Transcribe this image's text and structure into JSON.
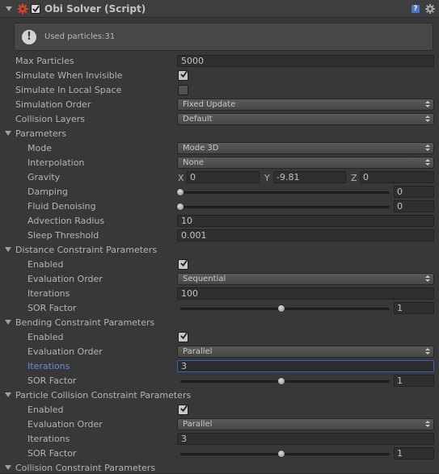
{
  "header": {
    "title": "Obi Solver (Script)",
    "help_glyph": "?",
    "icons": [
      "foldout-arrow-icon",
      "solver-gear-icon",
      "enabled-checkbox",
      "help-icon",
      "settings-gear-icon"
    ]
  },
  "info": {
    "glyph": "!",
    "message": "Used particles:31"
  },
  "rows": {
    "max_particles": {
      "label": "Max Particles",
      "value": "5000"
    },
    "simulate_when_invisible": {
      "label": "Simulate When Invisible",
      "checked": true
    },
    "simulate_in_local_space": {
      "label": "Simulate In Local Space",
      "checked": false
    },
    "simulation_order": {
      "label": "Simulation Order",
      "value": "Fixed Update"
    },
    "collision_layers": {
      "label": "Collision Layers",
      "value": "Default"
    }
  },
  "parameters": {
    "header": "Parameters",
    "mode": {
      "label": "Mode",
      "value": "Mode 3D"
    },
    "interpolation": {
      "label": "Interpolation",
      "value": "None"
    },
    "gravity": {
      "label": "Gravity",
      "x_label": "X",
      "x": "0",
      "y_label": "Y",
      "y": "-9.81",
      "z_label": "Z",
      "z": "0"
    },
    "damping": {
      "label": "Damping",
      "value": "0",
      "level": 0
    },
    "fluid_denoising": {
      "label": "Fluid Denoising",
      "value": "0",
      "level": 0
    },
    "advection_radius": {
      "label": "Advection Radius",
      "value": "10"
    },
    "sleep_threshold": {
      "label": "Sleep Threshold",
      "value": "0.001"
    }
  },
  "distance": {
    "header": "Distance Constraint Parameters",
    "enabled": {
      "label": "Enabled",
      "checked": true
    },
    "evaluation_order": {
      "label": "Evaluation Order",
      "value": "Sequential"
    },
    "iterations": {
      "label": "Iterations",
      "value": "100"
    },
    "sor_factor": {
      "label": "SOR Factor",
      "value": "1",
      "level": 0.5
    }
  },
  "bending": {
    "header": "Bending Constraint Parameters",
    "enabled": {
      "label": "Enabled",
      "checked": true
    },
    "evaluation_order": {
      "label": "Evaluation Order",
      "value": "Parallel"
    },
    "iterations": {
      "label": "Iterations",
      "value": "3"
    },
    "sor_factor": {
      "label": "SOR Factor",
      "value": "1",
      "level": 0.5
    }
  },
  "particle_collision": {
    "header": "Particle Collision Constraint Parameters",
    "enabled": {
      "label": "Enabled",
      "checked": true
    },
    "evaluation_order": {
      "label": "Evaluation Order",
      "value": "Parallel"
    },
    "iterations": {
      "label": "Iterations",
      "value": "3"
    },
    "sor_factor": {
      "label": "SOR Factor",
      "value": "1",
      "level": 0.5
    }
  },
  "collision": {
    "header": "Collision Constraint Parameters"
  },
  "colors": {
    "background": "#383838",
    "selected_label": "#6d8bd8",
    "focus_border": "#3a5fc0"
  }
}
